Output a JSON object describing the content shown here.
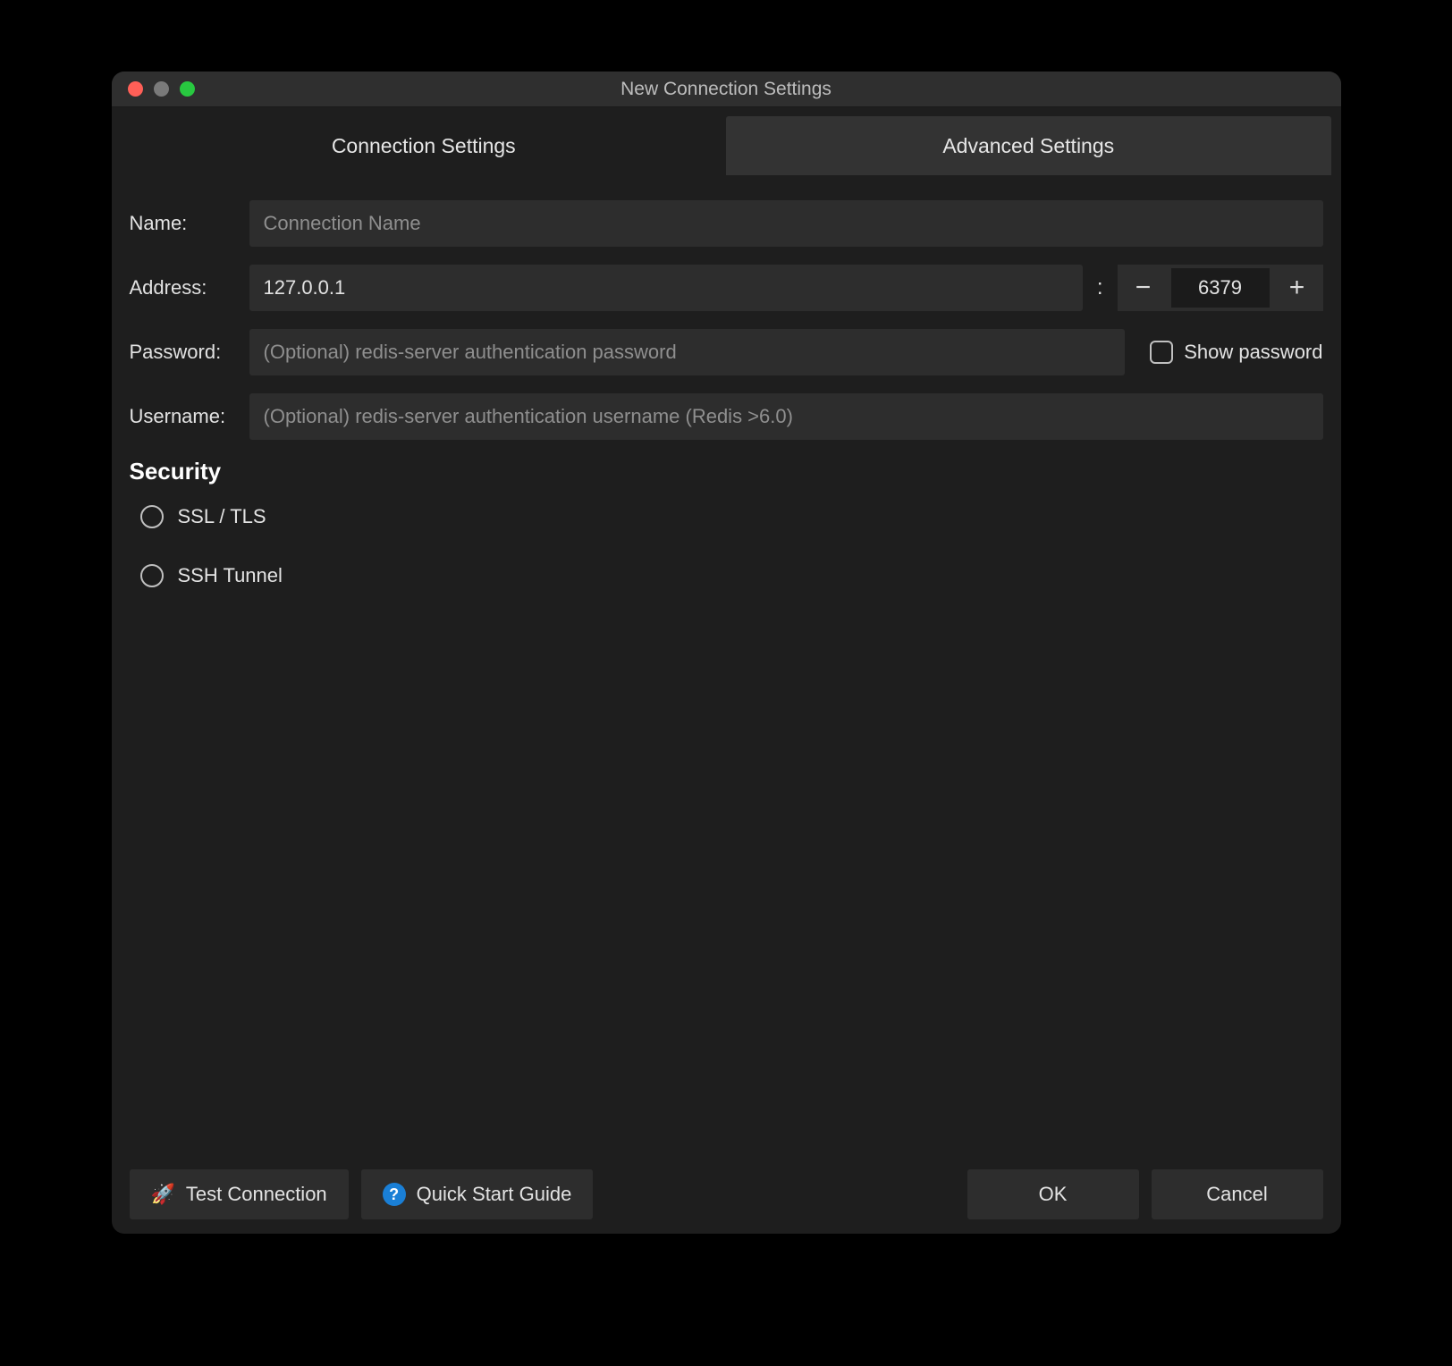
{
  "window": {
    "title": "New Connection Settings"
  },
  "tabs": {
    "connection": "Connection Settings",
    "advanced": "Advanced Settings"
  },
  "form": {
    "name_label": "Name:",
    "name_placeholder": "Connection Name",
    "name_value": "",
    "address_label": "Address:",
    "address_value": "127.0.0.1",
    "port_separator": ":",
    "port_value": "6379",
    "password_label": "Password:",
    "password_placeholder": "(Optional) redis-server authentication password",
    "password_value": "",
    "show_password_label": "Show password",
    "username_label": "Username:",
    "username_placeholder": "(Optional) redis-server authentication username (Redis >6.0)",
    "username_value": ""
  },
  "security": {
    "heading": "Security",
    "ssl_label": "SSL / TLS",
    "ssh_label": "SSH Tunnel"
  },
  "footer": {
    "test_label": "Test Connection",
    "guide_label": "Quick Start Guide",
    "ok_label": "OK",
    "cancel_label": "Cancel"
  },
  "icons": {
    "minus": "−",
    "plus": "+",
    "rocket": "🚀",
    "help": "?"
  }
}
